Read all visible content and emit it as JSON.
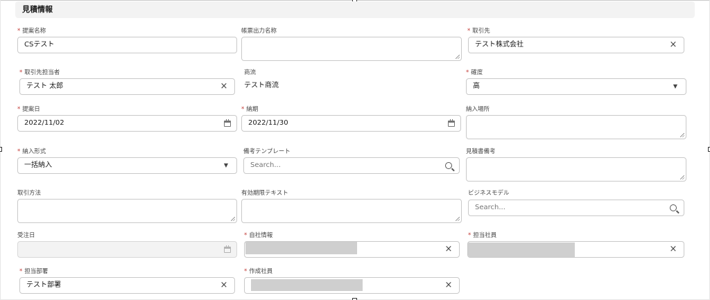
{
  "section": {
    "title": "見積情報"
  },
  "required_marker": "*",
  "fields": {
    "proposal_name": {
      "label": "提案名称",
      "value": "CSテスト"
    },
    "form_output_name": {
      "label": "帳票出力名称",
      "value": ""
    },
    "account": {
      "label": "取引先",
      "value": "テスト株式会社"
    },
    "account_contact": {
      "label": "取引先担当者",
      "value": "テスト 太郎"
    },
    "commercial_flow": {
      "label": "商流",
      "value": "テスト商流"
    },
    "certainty": {
      "label": "確度",
      "value": "高"
    },
    "proposal_date": {
      "label": "提案日",
      "value": "2022/11/02"
    },
    "delivery_date": {
      "label": "納期",
      "value": "2022/11/30"
    },
    "delivery_place": {
      "label": "納入場所",
      "value": ""
    },
    "delivery_form": {
      "label": "納入形式",
      "value": "一括納入"
    },
    "remarks_template": {
      "label": "備考テンプレート",
      "placeholder": "Search..."
    },
    "quote_remarks": {
      "label": "見積書備考",
      "value": ""
    },
    "transaction_method": {
      "label": "取引方法",
      "value": ""
    },
    "validity_text": {
      "label": "有効期限テキスト",
      "value": ""
    },
    "business_model": {
      "label": "ビジネスモデル",
      "placeholder": "Search..."
    },
    "order_date": {
      "label": "受注日",
      "value": ""
    },
    "company_info": {
      "label": "自社情報"
    },
    "staff_member": {
      "label": "担当社員"
    },
    "department": {
      "label": "担当部署",
      "value": "テスト部署"
    },
    "creator": {
      "label": "作成社員"
    }
  },
  "icons": {
    "clear": "×",
    "dropdown": "▼"
  }
}
